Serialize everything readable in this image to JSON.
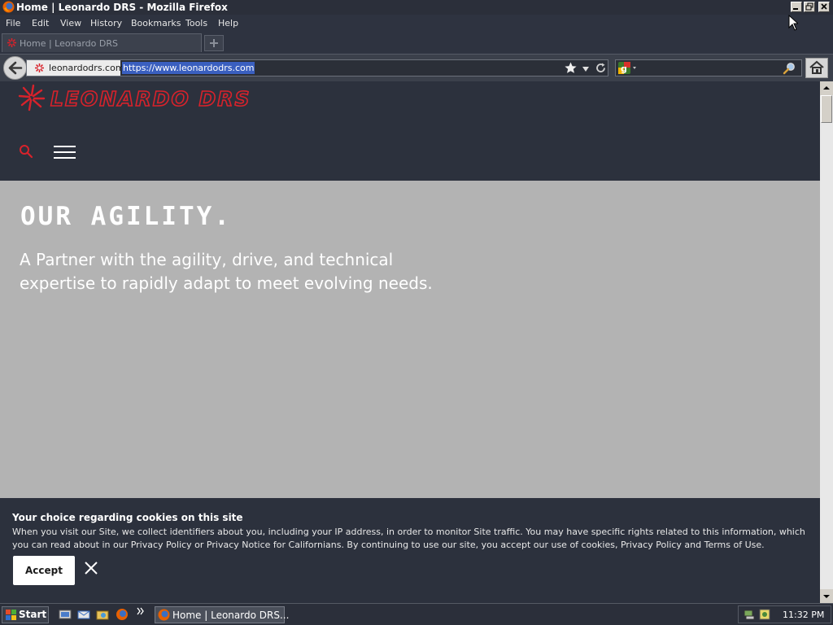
{
  "window": {
    "title": "Home | Leonardo DRS - Mozilla Firefox"
  },
  "menu": {
    "items": [
      "File",
      "Edit",
      "View",
      "History",
      "Bookmarks",
      "Tools",
      "Help"
    ]
  },
  "tab": {
    "title": "Home | Leonardo DRS"
  },
  "navbar": {
    "identity_label": "leonardodrs.com",
    "url": "https://www.leonardodrs.com"
  },
  "site": {
    "logo_text": "LEONARDO DRS",
    "hero_title": "OUR AGILITY.",
    "hero_text": "A Partner with the agility, drive, and technical expertise to rapidly adapt to meet evolving needs."
  },
  "cookie_banner": {
    "title": "Your choice regarding cookies on this site",
    "text": "When you visit our Site, we collect identifiers about you, including your IP address, in order to monitor Site traffic. You may have specific rights related to this information, which you can read about in our Privacy Policy or Privacy Notice for Californians. By continuing to use our site, you accept our use of cookies, Privacy Policy and Terms of Use.",
    "accept_label": "Accept"
  },
  "taskbar": {
    "start_label": "Start",
    "task_label": "Home | Leonardo DRS...",
    "clock": "11:32 PM"
  },
  "colors": {
    "brand_red": "#d8222b",
    "header_bg": "#2c313d",
    "hero_bg": "#b3b3b3"
  }
}
